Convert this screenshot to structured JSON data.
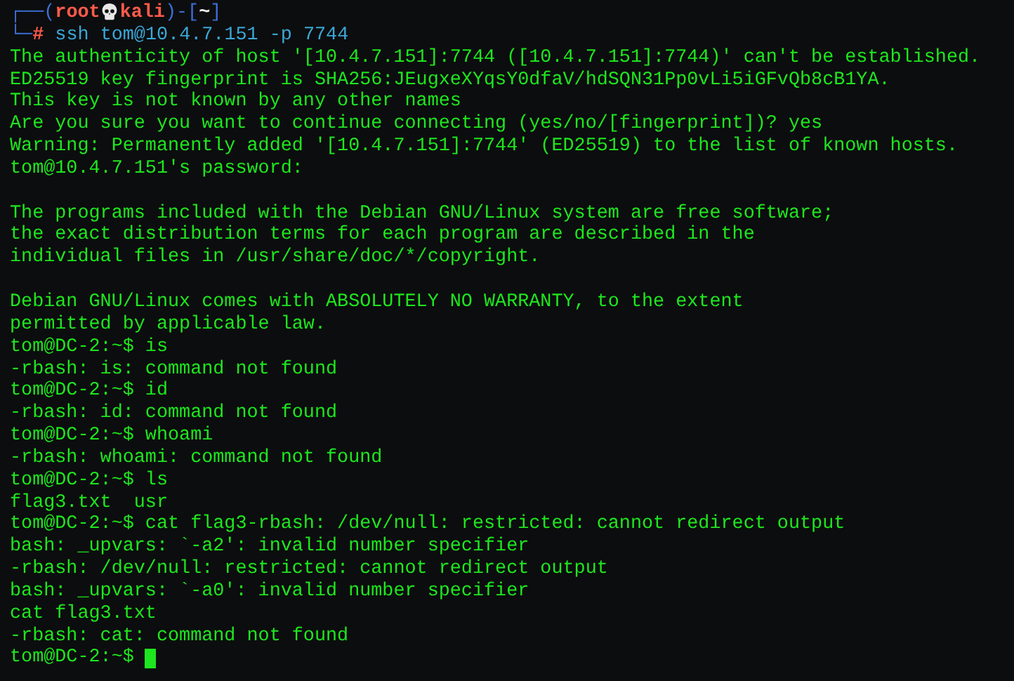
{
  "prompt_header": {
    "open": "┌──(",
    "user": "root",
    "host": "kali",
    "separator": ")-[",
    "cwd": "~",
    "close": "]"
  },
  "lines": [
    {
      "kind": "root_command",
      "corner": "└─",
      "symbol": "#",
      "text": "ssh tom@10.4.7.151 -p 7744"
    },
    {
      "kind": "output",
      "text": "The authenticity of host '[10.4.7.151]:7744 ([10.4.7.151]:7744)' can't be established."
    },
    {
      "kind": "output",
      "text": "ED25519 key fingerprint is SHA256:JEugxeXYqsY0dfaV/hdSQN31Pp0vLi5iGFvQb8cB1YA."
    },
    {
      "kind": "output",
      "text": "This key is not known by any other names"
    },
    {
      "kind": "output",
      "text": "Are you sure you want to continue connecting (yes/no/[fingerprint])? yes"
    },
    {
      "kind": "output",
      "text": "Warning: Permanently added '[10.4.7.151]:7744' (ED25519) to the list of known hosts."
    },
    {
      "kind": "output",
      "text": "tom@10.4.7.151's password:"
    },
    {
      "kind": "blank"
    },
    {
      "kind": "output",
      "text": "The programs included with the Debian GNU/Linux system are free software;"
    },
    {
      "kind": "output",
      "text": "the exact distribution terms for each program are described in the"
    },
    {
      "kind": "output",
      "text": "individual files in /usr/share/doc/*/copyright."
    },
    {
      "kind": "blank"
    },
    {
      "kind": "output",
      "text": "Debian GNU/Linux comes with ABSOLUTELY NO WARRANTY, to the extent"
    },
    {
      "kind": "output",
      "text": "permitted by applicable law."
    },
    {
      "kind": "output",
      "text": "tom@DC-2:~$ is"
    },
    {
      "kind": "output",
      "text": "-rbash: is: command not found"
    },
    {
      "kind": "output",
      "text": "tom@DC-2:~$ id"
    },
    {
      "kind": "output",
      "text": "-rbash: id: command not found"
    },
    {
      "kind": "output",
      "text": "tom@DC-2:~$ whoami"
    },
    {
      "kind": "output",
      "text": "-rbash: whoami: command not found"
    },
    {
      "kind": "output",
      "text": "tom@DC-2:~$ ls"
    },
    {
      "kind": "output",
      "text": "flag3.txt  usr"
    },
    {
      "kind": "output",
      "text": "tom@DC-2:~$ cat flag3-rbash: /dev/null: restricted: cannot redirect output"
    },
    {
      "kind": "output",
      "text": "bash: _upvars: `-a2': invalid number specifier"
    },
    {
      "kind": "output",
      "text": "-rbash: /dev/null: restricted: cannot redirect output"
    },
    {
      "kind": "output",
      "text": "bash: _upvars: `-a0': invalid number specifier"
    },
    {
      "kind": "output",
      "text": "cat flag3.txt"
    },
    {
      "kind": "output",
      "text": "-rbash: cat: command not found"
    },
    {
      "kind": "cursor_prompt",
      "text": "tom@DC-2:~$"
    }
  ]
}
